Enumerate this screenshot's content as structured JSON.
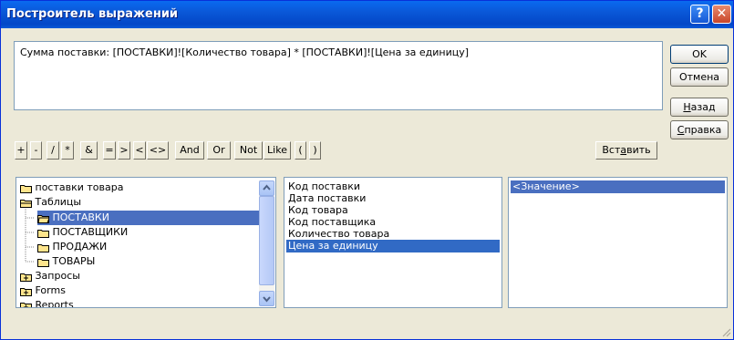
{
  "window": {
    "title": "Построитель выражений"
  },
  "titlebar": {
    "help": "?",
    "close": "✕"
  },
  "expression": {
    "value": "Сумма поставки:  [ПОСТАВКИ]![Количество товара] * [ПОСТАВКИ]![Цена за единицу]"
  },
  "buttons": {
    "ok": "OK",
    "cancel": "Отмена",
    "back_pre": "",
    "back_u": "Н",
    "back_post": "азад",
    "help_pre": "",
    "help_u": "С",
    "help_post": "правка",
    "insert_pre": "Вст",
    "insert_u": "а",
    "insert_post": "вить"
  },
  "operators": [
    "+",
    "-",
    "/",
    "*",
    "&",
    "=",
    ">",
    "<",
    "<>",
    "And",
    "Or",
    "Not",
    "Like",
    "(",
    ")"
  ],
  "tree": [
    "поставки товара",
    "Таблицы",
    "ПОСТАВКИ",
    "ПОСТАВЩИКИ",
    "ПРОДАЖИ",
    "ТОВАРЫ",
    "Запросы",
    "Forms",
    "Reports"
  ],
  "fields": [
    "Код поставки",
    "Дата поставки",
    "Код товара",
    "Код поставщика",
    "Количество товара",
    "Цена за единицу"
  ],
  "values": [
    "<Значение>"
  ],
  "colors": {
    "selection": "#316ac5",
    "titlebar": "#0a58d8",
    "dialog": "#ece9d8"
  }
}
